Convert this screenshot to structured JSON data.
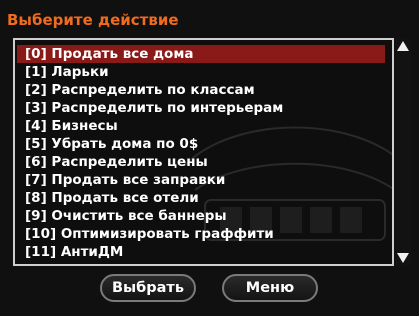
{
  "dialog": {
    "title": "Выберите действие",
    "items": [
      "[0] Продать все дома",
      "[1] Ларьки",
      "[2] Распределить по классам",
      "[3] Распределить по интерьерам",
      "[4] Бизнесы",
      "[5] Убрать дома по 0$",
      "[6] Распределить цены",
      "[7] Продать все заправки",
      "[8] Продать все отели",
      "[9] Очистить все баннеры",
      "[10] Оптимизировать граффити",
      "[11] АнтиДМ"
    ],
    "selected_index": 0,
    "buttons": {
      "select": "Выбрать",
      "menu": "Меню"
    }
  },
  "colors": {
    "title": "#ee6b1f",
    "selected_row": "#8a1a17",
    "item_text": "#ffffff"
  }
}
